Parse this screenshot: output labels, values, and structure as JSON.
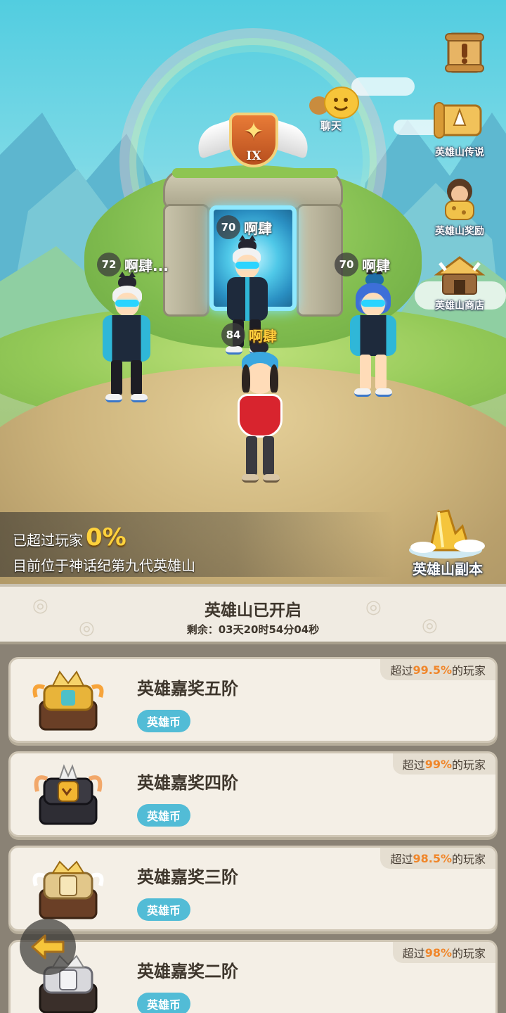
{
  "scene": {
    "gate_rank": "IX",
    "chat_label": "聊天",
    "side_menu": [
      {
        "label": "英雄山传说",
        "icon": "legend-scroll-icon"
      },
      {
        "label": "英雄山奖励",
        "icon": "caveman-reward-icon"
      },
      {
        "label": "英雄山商店",
        "icon": "hut-shop-icon"
      }
    ],
    "players": [
      {
        "level": "70",
        "name": "啊肆"
      },
      {
        "level": "72",
        "name": "啊肆..."
      },
      {
        "level": "70",
        "name": "啊肆"
      },
      {
        "level": "84",
        "name": "啊肆"
      }
    ],
    "surpass_label": "已超过玩家",
    "surpass_percent": "0%",
    "position_text": "目前位于神话纪第九代英雄山",
    "dungeon_label": "英雄山副本"
  },
  "status": {
    "title": "英雄山已开启",
    "countdown": "剩余：03天20时54分04秒"
  },
  "rewards": [
    {
      "name": "英雄嘉奖五阶",
      "currency": "英雄币",
      "rank_prefix": "超过",
      "rank_value": "99.5%",
      "rank_suffix": "的玩家",
      "chest_color": "#e8b43a"
    },
    {
      "name": "英雄嘉奖四阶",
      "currency": "英雄币",
      "rank_prefix": "超过",
      "rank_value": "99%",
      "rank_suffix": "的玩家",
      "chest_color": "#3b3a42"
    },
    {
      "name": "英雄嘉奖三阶",
      "currency": "英雄币",
      "rank_prefix": "超过",
      "rank_value": "98.5%",
      "rank_suffix": "的玩家",
      "chest_color": "#e2c78a"
    },
    {
      "name": "英雄嘉奖二阶",
      "currency": "英雄币",
      "rank_prefix": "超过",
      "rank_value": "98%",
      "rank_suffix": "的玩家",
      "chest_color": "#d8d8dc"
    }
  ]
}
